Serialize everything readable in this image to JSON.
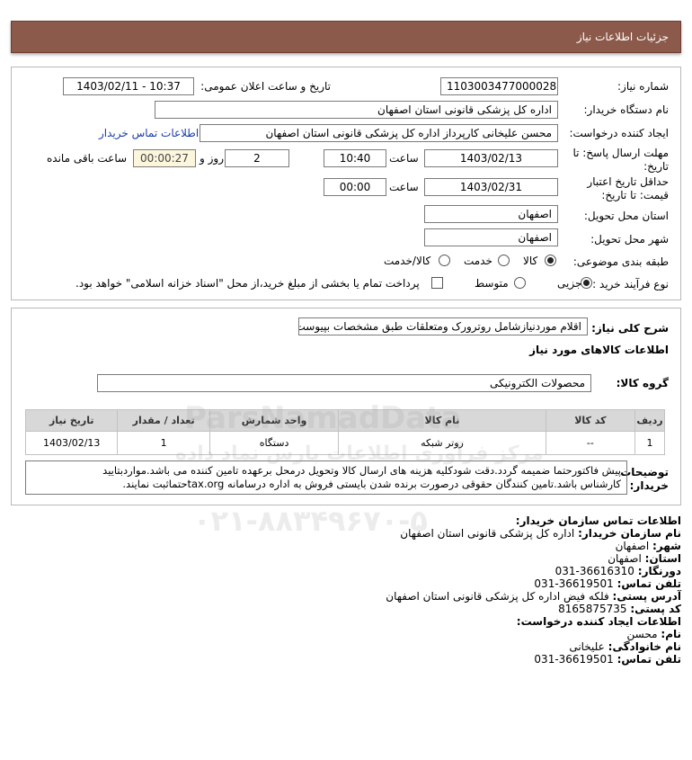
{
  "header": {
    "title": "جزئیات اطلاعات نیاز"
  },
  "form": {
    "need_number_label": "شماره نیاز:",
    "need_number": "1103003477000028",
    "announce_label": "تاریخ و ساعت اعلان عمومی:",
    "announce_value": "1403/02/11 - 10:37",
    "buyer_org_label": "نام دستگاه خریدار:",
    "buyer_org": "اداره کل پزشکی قانونی استان اصفهان",
    "creator_label": "ایجاد کننده درخواست:",
    "creator": "محسن علیخانی کارپرداز اداره کل پزشکی قانونی استان اصفهان",
    "buyer_contact_link": "اطلاعات تماس خریدار",
    "deadline_label_1": "مهلت ارسال پاسخ: تا",
    "deadline_label_2": "تاریخ:",
    "deadline_date": "1403/02/13",
    "time_label": "ساعت",
    "deadline_time": "10:40",
    "days_value": "2",
    "days_label": "روز و",
    "remaining_time": "00:00:27",
    "remaining_label": "ساعت باقی مانده",
    "validity_label_1": "حداقل تاریخ اعتبار",
    "validity_label_2": "قیمت: تا تاریخ:",
    "validity_date": "1403/02/31",
    "validity_time": "00:00",
    "province_label": "استان محل تحویل:",
    "province": "اصفهان",
    "city_label": "شهر محل تحویل:",
    "city": "اصفهان",
    "category_label": "طبقه بندی موضوعی:",
    "category_options": [
      "کالا",
      "خدمت",
      "کالا/خدمت"
    ],
    "process_label": "نوع فرآیند خرید :",
    "process_options": [
      "جزیی",
      "متوسط"
    ],
    "payment_note": "پرداخت تمام یا بخشی از مبلغ خرید،از محل \"اسناد خزانه اسلامی\" خواهد بود."
  },
  "details": {
    "summary_label": "شرح کلی نیاز:",
    "summary": "اقلام موردنیازشامل روترورک ومتعلقات طبق مشخصات بپیوست",
    "items_title": "اطلاعات کالاهای مورد نیاز",
    "group_label": "گروه کالا:",
    "group_value": "محصولات الکترونیکی",
    "table_headers": [
      "ردیف",
      "کد کالا",
      "نام کالا",
      "واحد شمارش",
      "تعداد / مقدار",
      "تاریخ نیاز"
    ],
    "rows": [
      [
        "1",
        "--",
        "روتر شبکه",
        "دستگاه",
        "1",
        "1403/02/13"
      ]
    ],
    "notes_label_1": "توضیحات",
    "notes_label_2": "خریدار:",
    "notes_line_1": "پیش فاکتورحتما ضمیمه گردد.دقت شودکلیه هزینه های ارسال کالا وتحویل درمحل برعهده تامین کننده می باشد.مواردبتایید",
    "notes_line_2": "کارشناس باشد.تامین کنندگان حقوقی درصورت برنده شدن بایستی فروش به اداره درسامانه tax.orgحتماثبت نمایند."
  },
  "contact": {
    "title": "اطلاعات تماس سازمان خریدار:",
    "org_label": "نام سازمان خریدار:",
    "org": "اداره کل پزشکی قانونی استان اصفهان",
    "city_label": "شهر:",
    "city": "اصفهان",
    "province_label": "استان:",
    "province": "اصفهان",
    "fax_label": "دورنگار:",
    "fax": "031-36616310",
    "phone_label": "تلفن تماس:",
    "phone": "031-36619501",
    "address_label": "آدرس پستی:",
    "address": "فلکه فیض اداره کل پزشکی قانونی استان اصفهان",
    "postal_label": "کد پستی:",
    "postal": "8165875735",
    "creator_title": "اطلاعات ایجاد کننده درخواست:",
    "first_name_label": "نام:",
    "first_name": "محسن",
    "last_name_label": "نام خانوادگی:",
    "last_name": "علیخانی",
    "creator_phone_label": "تلفن تماس:",
    "creator_phone": "031-36619501"
  },
  "watermark": {
    "line_1": "ParsNamadData",
    "line_2": "مرکز فرآوری اطلاعات پارس نماد داده",
    "line_3": "۰۲۱-۸۸۳۴۹۶۷۰-۵"
  },
  "colors": {
    "header_bg": "#8c5a4b",
    "link": "#1a3fa8",
    "remaining_bg": "#fbf6dc"
  }
}
